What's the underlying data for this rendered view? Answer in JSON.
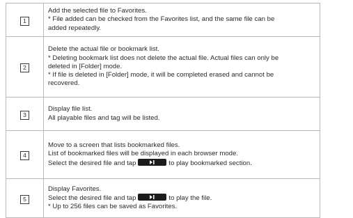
{
  "rows": [
    {
      "number": "1",
      "lines": [
        "Add the selected file to Favorites.",
        "* File added can be checked from the Favorites list, and the same file can be",
        "  added repeatedly."
      ]
    },
    {
      "number": "2",
      "lines": [
        "Delete the actual file or bookmark list.",
        "* Deleting bookmark list does not delete the actual file. Actual files can only be",
        "  deleted in [Folder] mode.",
        "* If file is deleted in [Folder] mode, it will be completed erased and cannot be",
        "  recovered."
      ]
    },
    {
      "number": "3",
      "lines": [
        "Display file list.",
        "All playable files and tag will be listed."
      ]
    },
    {
      "number": "4",
      "lines": [
        "Move to a screen that lists bookmarked files.",
        "List of bookmarked files will be displayed in each browser mode."
      ],
      "button_line_before": "Select the desired file and tap",
      "button_line_after": "to play bookmarked section."
    },
    {
      "number": "5",
      "lines_before": [
        "Display Favorites."
      ],
      "button_line_before": "Select the desired file and tap",
      "button_line_after": "to play the file.",
      "lines_after": [
        "* Up to 256 files can be saved as Favorites."
      ]
    }
  ],
  "button_icon": "skip-next-icon"
}
